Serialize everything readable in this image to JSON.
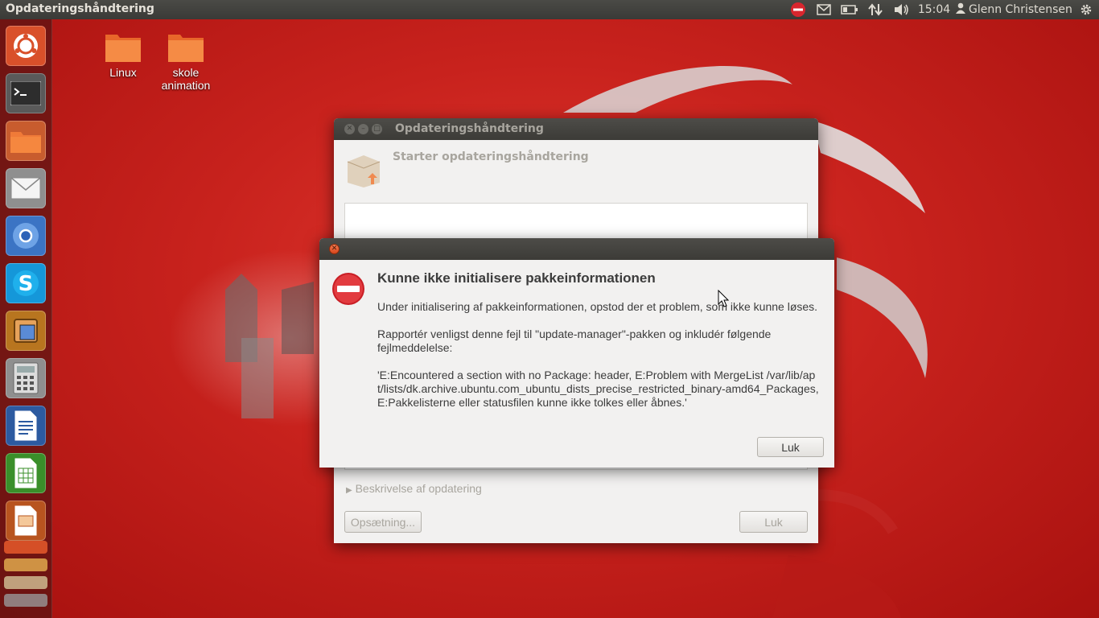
{
  "top_panel": {
    "title": "Opdateringshåndtering",
    "time": "15:04",
    "user": "Glenn Christensen"
  },
  "desktop": {
    "icons": [
      {
        "label": "Linux",
        "icon": "folder-icon"
      },
      {
        "label": "skole animation",
        "icon": "folder-icon"
      }
    ]
  },
  "launcher": {
    "items": [
      "ubuntu-dash-icon",
      "terminal-icon",
      "files-icon",
      "mail-icon",
      "chromium-icon",
      "skype-icon",
      "virtualbox-icon",
      "calculator-icon",
      "writer-icon",
      "calc-icon",
      "impress-icon"
    ]
  },
  "update_manager": {
    "title": "Opdateringshåndtering",
    "heading": "Starter opdateringshåndtering",
    "description_expander": "Beskrivelse af opdatering",
    "settings_button": "Opsætning...",
    "close_button": "Luk"
  },
  "error_dialog": {
    "heading": "Kunne ikke initialisere pakkeinformationen",
    "para1": "Under initialisering af pakkeinformationen, opstod der et problem, som ikke kunne løses.",
    "para2": "Rapportér venligst denne fejl til \"update-manager\"-pakken og inkludér følgende fejlmeddelelse:",
    "para3": "'E:Encountered a section with no Package: header, E:Problem with MergeList /var/lib/apt/lists/dk.archive.ubuntu.com_ubuntu_dists_precise_restricted_binary-amd64_Packages, E:Pakkelisterne eller statusfilen kunne ikke tolkes eller åbnes.'",
    "close_button": "Luk"
  },
  "colors": {
    "accent": "#dd4814",
    "panel": "#3c3b37",
    "error_red": "#d8262e"
  }
}
